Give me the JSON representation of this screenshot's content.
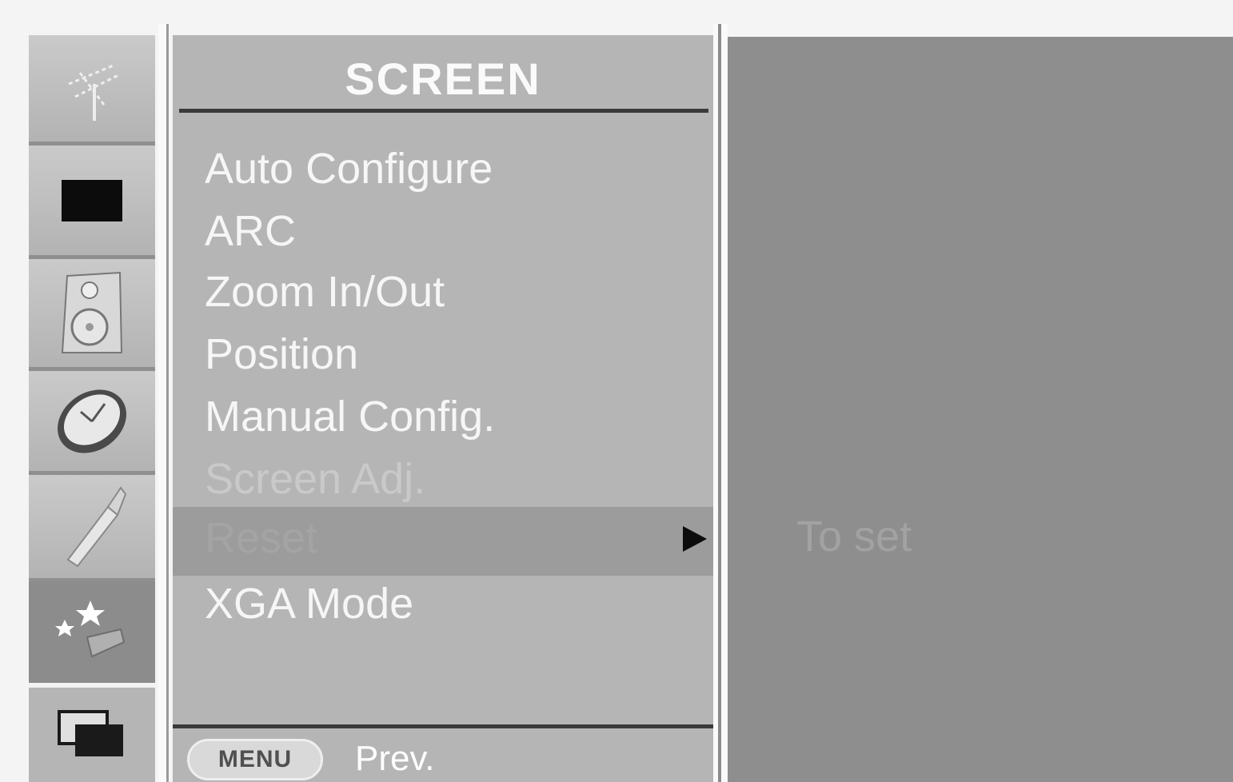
{
  "menu": {
    "title": "SCREEN",
    "items": [
      {
        "label": "Auto Configure"
      },
      {
        "label": "ARC"
      },
      {
        "label": "Zoom In/Out"
      },
      {
        "label": "Position"
      },
      {
        "label": "Manual Config."
      },
      {
        "label": "Screen Adj."
      },
      {
        "label": "Reset"
      },
      {
        "label": "XGA Mode"
      }
    ],
    "selected_item": "Reset"
  },
  "footer": {
    "menu_key": "MENU",
    "prev_label": "Prev."
  },
  "info": {
    "text": "To set"
  },
  "side_icons": [
    "antenna-icon",
    "picture-icon",
    "speaker-icon",
    "clock-icon",
    "tool-icon",
    "screen-settings-icon",
    "pip-icon"
  ]
}
